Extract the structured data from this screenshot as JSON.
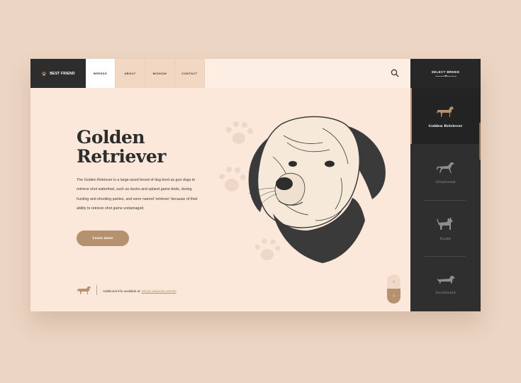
{
  "brand": {
    "name": "BEST FRIEND",
    "icon": "paw-icon"
  },
  "nav": {
    "items": [
      {
        "label": "BREEDS",
        "active": true
      },
      {
        "label": "ABOUT"
      },
      {
        "label": "MISSION"
      },
      {
        "label": "CONTACT"
      }
    ]
  },
  "search": {
    "icon": "search-icon"
  },
  "hero": {
    "title": "Golden Retriever",
    "description": "The Golden Retriever is a large-sized breed of dog bred as gun dogs to retrieve shot waterfowl, such as ducks and upland game birds, during hunting and shooting parties, and were named 'retriever' because of their ability to retrieve shot game undamaged.",
    "button_label": "Learn more"
  },
  "footer": {
    "text": "Additional info available at:",
    "link": "Oficial wikipedia website"
  },
  "panel": {
    "title": "SELECT BREED",
    "breeds": [
      {
        "name": "Golden Retriever",
        "active": true
      },
      {
        "name": "Greyhound"
      },
      {
        "name": "Husky"
      },
      {
        "name": "Dachshund"
      }
    ]
  },
  "colors": {
    "accent": "#b5916f",
    "dark": "#2f2f2f",
    "background": "#fbe8da",
    "page": "#ecd5c3"
  }
}
